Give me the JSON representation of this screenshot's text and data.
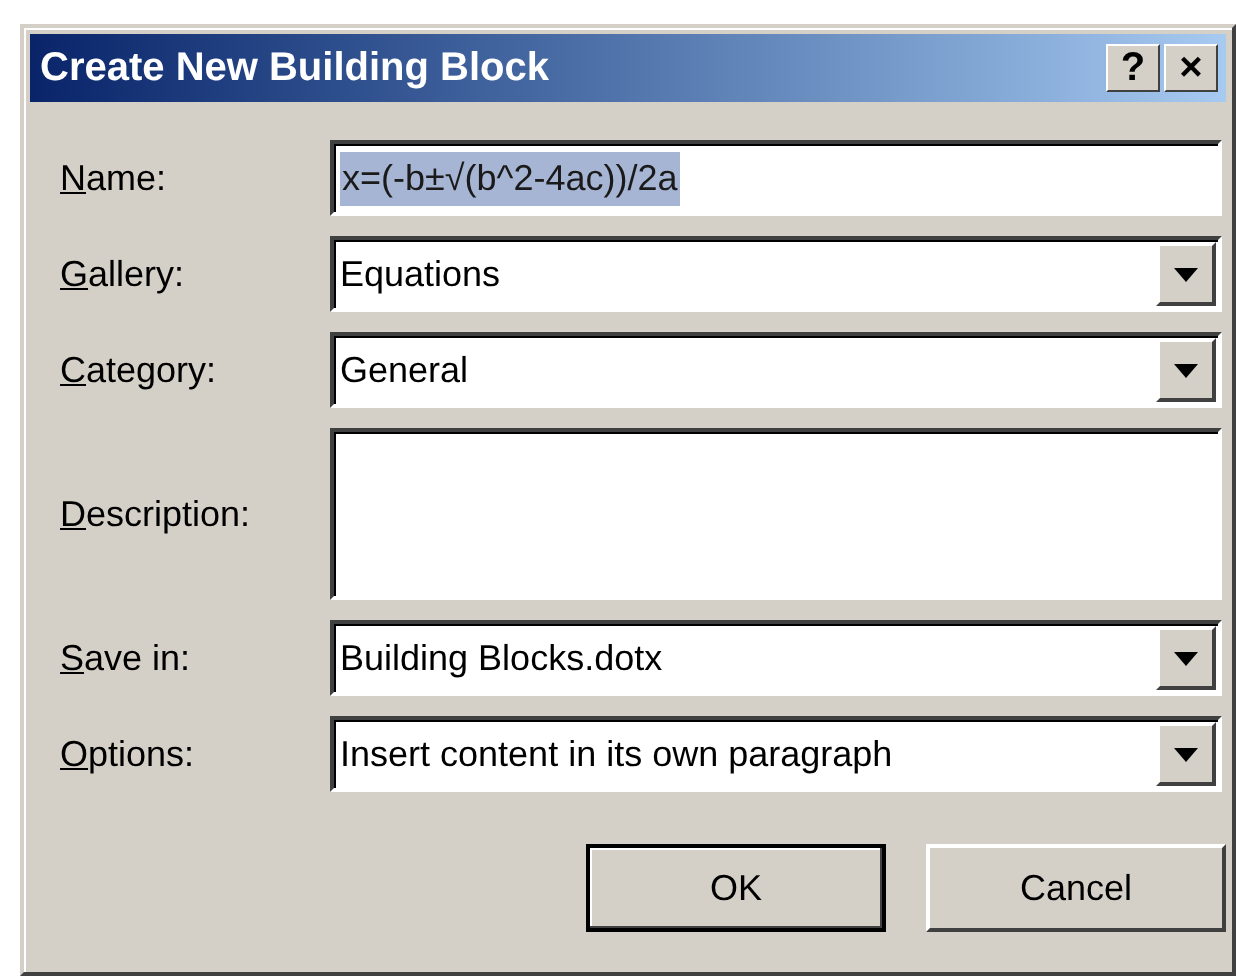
{
  "window": {
    "title": "Create New Building Block",
    "buttons": [
      "?",
      "×"
    ]
  },
  "fields": [
    {
      "label": "Name:",
      "kind": "text",
      "value": "x=(-b±√(b^2-4ac))/2a",
      "selected": true
    },
    {
      "label": "Gallery:",
      "kind": "dropdown",
      "value": "Equations"
    },
    {
      "label": "Category:",
      "kind": "dropdown",
      "value": "General"
    },
    {
      "label": "Description:",
      "kind": "textarea"
    },
    {
      "label": "Save in:",
      "kind": "dropdown",
      "value": "Building Blocks.dotx"
    },
    {
      "label": "Options:",
      "kind": "dropdown",
      "value": "Insert content in its own paragraph"
    }
  ],
  "buttons": [
    "OK",
    "Cancel"
  ]
}
